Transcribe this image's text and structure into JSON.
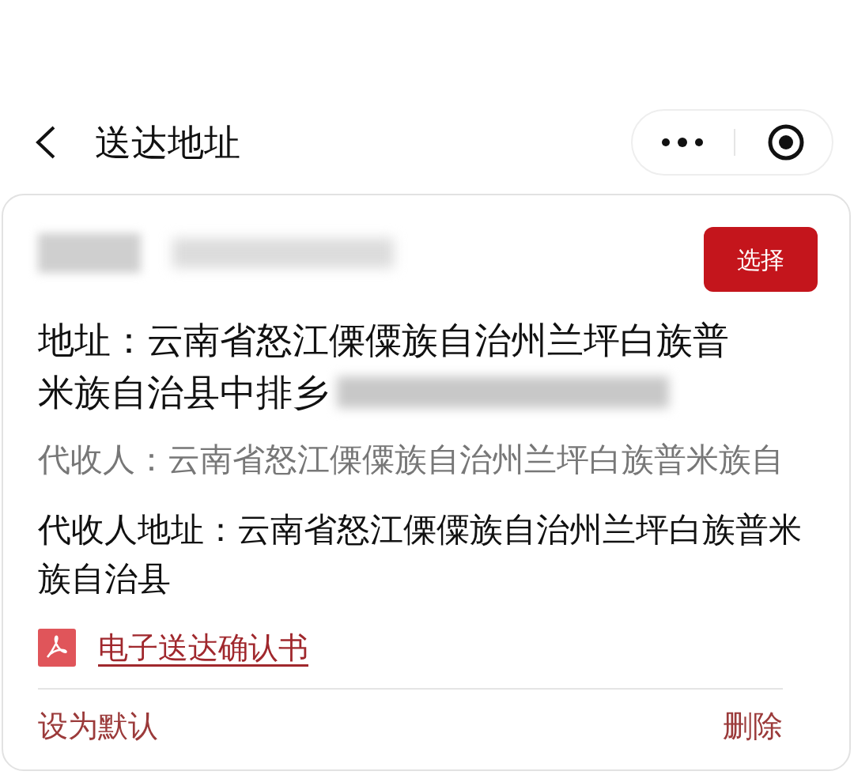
{
  "header": {
    "title": "送达地址"
  },
  "card": {
    "select_button": "选择",
    "address_lines": [
      "地址：云南省怒江傈僳族自治州兰坪白族普",
      "米族自治县中排乡"
    ],
    "agent": "代收人：云南省怒江傈僳族自治州兰坪白族普米族自",
    "agent_address": "代收人地址：云南省怒江傈僳族自治州兰坪白族普米族自治县",
    "document_link": "电子送达确认书",
    "actions": [
      "设为默认",
      "删除"
    ]
  }
}
